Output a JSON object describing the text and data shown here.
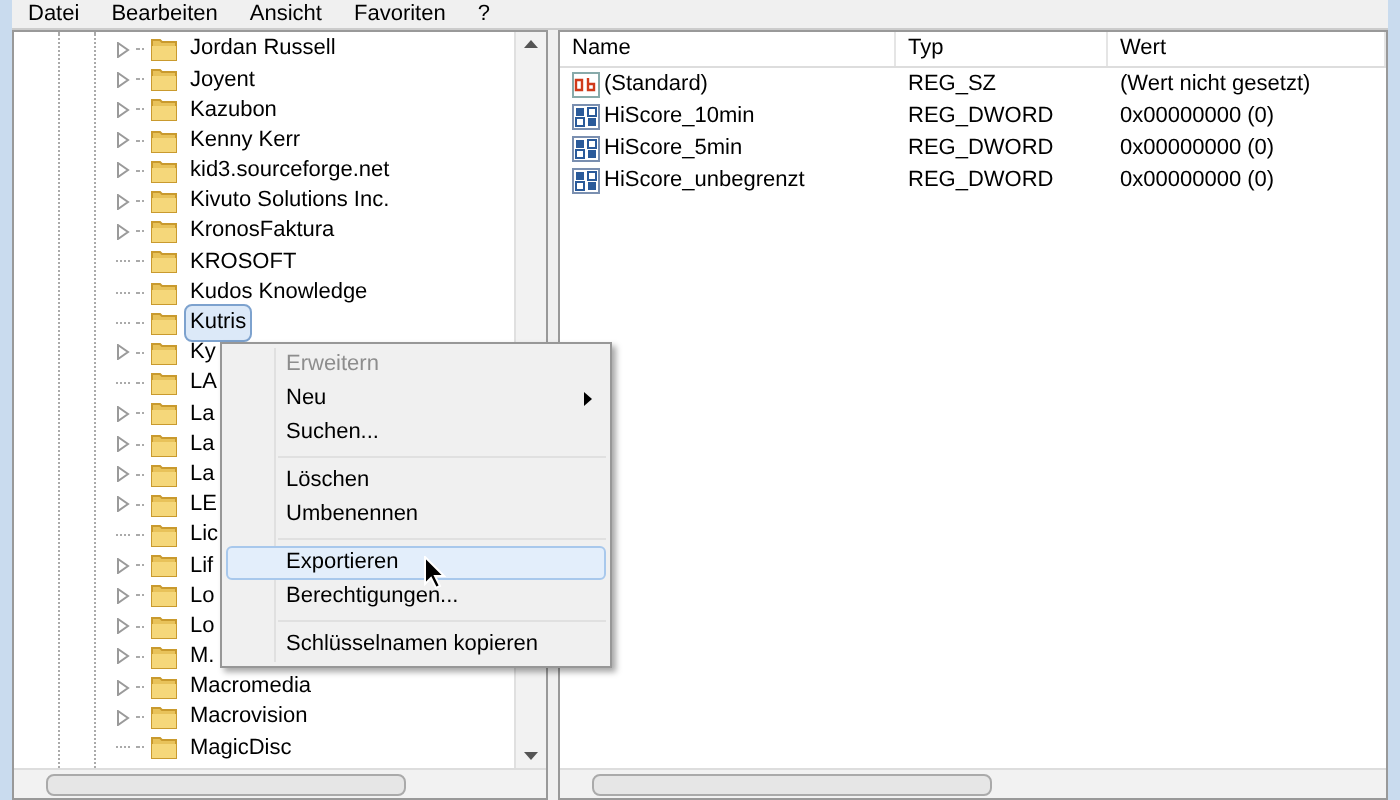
{
  "menu_bar": [
    "Datei",
    "Bearbeiten",
    "Ansicht",
    "Favoriten",
    "?"
  ],
  "tree": {
    "items": [
      {
        "label": "Jordan Russell",
        "expandable": true,
        "selected": false
      },
      {
        "label": "Joyent",
        "expandable": true,
        "selected": false
      },
      {
        "label": "Kazubon",
        "expandable": true,
        "selected": false
      },
      {
        "label": "Kenny Kerr",
        "expandable": true,
        "selected": false
      },
      {
        "label": "kid3.sourceforge.net",
        "expandable": true,
        "selected": false
      },
      {
        "label": "Kivuto Solutions Inc.",
        "expandable": true,
        "selected": false
      },
      {
        "label": "KronosFaktura",
        "expandable": true,
        "selected": false
      },
      {
        "label": "KROSOFT",
        "expandable": false,
        "selected": false
      },
      {
        "label": "Kudos Knowledge",
        "expandable": false,
        "selected": false
      },
      {
        "label": "Kutris",
        "expandable": false,
        "selected": true
      },
      {
        "label": "Ky",
        "expandable": true,
        "selected": false
      },
      {
        "label": "LA",
        "expandable": false,
        "selected": false
      },
      {
        "label": "La",
        "expandable": true,
        "selected": false
      },
      {
        "label": "La",
        "expandable": true,
        "selected": false
      },
      {
        "label": "La",
        "expandable": true,
        "selected": false
      },
      {
        "label": "LE",
        "expandable": true,
        "selected": false
      },
      {
        "label": "Lic",
        "expandable": false,
        "selected": false
      },
      {
        "label": "Lif",
        "expandable": true,
        "selected": false
      },
      {
        "label": "Lo",
        "expandable": true,
        "selected": false
      },
      {
        "label": "Lo",
        "expandable": true,
        "selected": false
      },
      {
        "label": "M.",
        "expandable": true,
        "selected": false
      },
      {
        "label": "Macromedia",
        "expandable": true,
        "selected": false
      },
      {
        "label": "Macrovision",
        "expandable": true,
        "selected": false
      },
      {
        "label": "MagicDisc",
        "expandable": false,
        "selected": false
      }
    ]
  },
  "values": {
    "columns": [
      "Name",
      "Typ",
      "Wert"
    ],
    "rows": [
      {
        "kind": "string",
        "name": "(Standard)",
        "type": "REG_SZ",
        "value": "(Wert nicht gesetzt)"
      },
      {
        "kind": "dword",
        "name": "HiScore_10min",
        "type": "REG_DWORD",
        "value": "0x00000000 (0)"
      },
      {
        "kind": "dword",
        "name": "HiScore_5min",
        "type": "REG_DWORD",
        "value": "0x00000000 (0)"
      },
      {
        "kind": "dword",
        "name": "HiScore_unbegrenzt",
        "type": "REG_DWORD",
        "value": "0x00000000 (0)"
      }
    ]
  },
  "context_menu": {
    "items": [
      {
        "kind": "item",
        "label": "Erweitern",
        "disabled": true,
        "submenu": false,
        "selected": false
      },
      {
        "kind": "item",
        "label": "Neu",
        "disabled": false,
        "submenu": true,
        "selected": false
      },
      {
        "kind": "item",
        "label": "Suchen...",
        "disabled": false,
        "submenu": false,
        "selected": false
      },
      {
        "kind": "separator"
      },
      {
        "kind": "item",
        "label": "Löschen",
        "disabled": false,
        "submenu": false,
        "selected": false
      },
      {
        "kind": "item",
        "label": "Umbenennen",
        "disabled": false,
        "submenu": false,
        "selected": false
      },
      {
        "kind": "separator"
      },
      {
        "kind": "item",
        "label": "Exportieren",
        "disabled": false,
        "submenu": false,
        "selected": true
      },
      {
        "kind": "item",
        "label": "Berechtigungen...",
        "disabled": false,
        "submenu": false,
        "selected": false
      },
      {
        "kind": "separator"
      },
      {
        "kind": "item",
        "label": "Schlüsselnamen kopieren",
        "disabled": false,
        "submenu": false,
        "selected": false
      }
    ]
  }
}
